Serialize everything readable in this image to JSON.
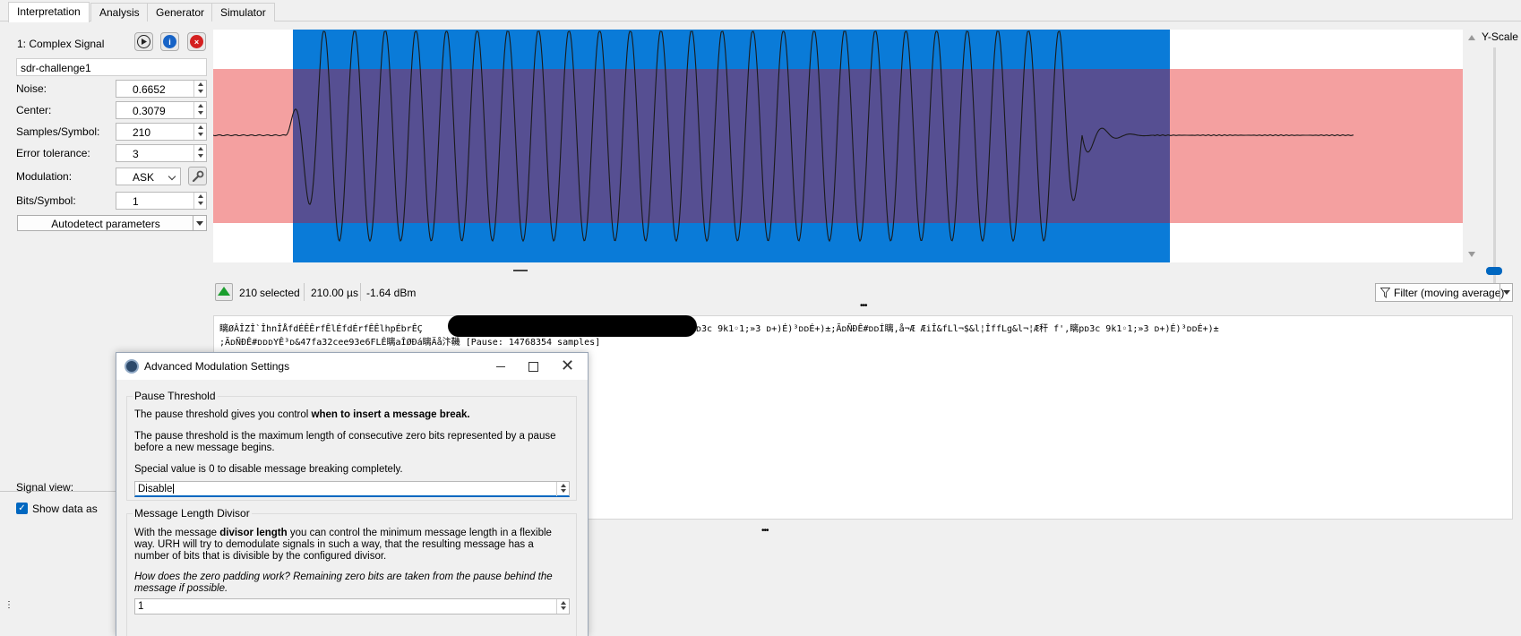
{
  "tabs": [
    {
      "label": "Interpretation"
    },
    {
      "label": "Analysis"
    },
    {
      "label": "Generator"
    },
    {
      "label": "Simulator"
    }
  ],
  "signal": {
    "title": "1:  Complex Signal",
    "name": "sdr-challenge1",
    "noise_label": "Noise:",
    "noise": "0.6652",
    "center_label": "Center:",
    "center": "0.3079",
    "sps_label": "Samples/Symbol:",
    "sps": "210",
    "tol_label": "Error tolerance:",
    "tol": "3",
    "mod_label": "Modulation:",
    "modulation": "ASK",
    "bits_label": "Bits/Symbol:",
    "bits": "1",
    "autodetect": "Autodetect parameters",
    "signal_view_label": "Signal view:",
    "show_data_label": "Show data as"
  },
  "plot": {
    "yscale_label": "Y-Scale",
    "colors": {
      "selection": "#0a7bd8",
      "noise_band": "#f4a0a0",
      "overlap": "#564f92",
      "wave": "#1a1a1a"
    }
  },
  "status": {
    "selected_count": "210",
    "selected_label": "selected",
    "duration": "210.00 µs",
    "power": "-1.64 dBm",
    "filter": "Filter (moving average)"
  },
  "demod": {
    "line1": "瞝ØÂÎZÎ`ÎhnÎÅfdÉÊÊrfÊlÉfdÉrfÊÊlhpÉbrÊÇ",
    "line1b": "ᴅ3c 9k1◦1;»3 ᴅ+)É)³ᴅᴅÉ+)±;ÃᴅÑÐÊ#ᴅᴅÍ瞝,å¬Æ ÆiÎ&fLl¬$&l¦ÎffLg&l¬¦Æ秆 f',瞝pᴅ3c 9k1◦1;»3 ᴅ+)É)³ᴅᴅÉ+)±",
    "line2": ";ÃᴅÑÐÊ#ᴅᴅᴅYÊ³ᴅ&47fa32cee93e6FLÊ瞝aÎØÐá瞝Äå汴鞿 [Pause: 14768354 samples]"
  },
  "dialog": {
    "title": "Advanced Modulation Settings",
    "pause_group": "Pause Threshold",
    "pause_p1_a": "The pause threshold gives you control ",
    "pause_p1_b": "when to insert a message break.",
    "pause_p2": "The pause threshold is the maximum length of consecutive zero bits represented by a pause before a new message begins.",
    "pause_p3": "Special value is 0 to disable message breaking completely.",
    "pause_value": "Disable",
    "len_group": "Message Length Divisor",
    "len_p1_a": "With the message ",
    "len_p1_b": "divisor length",
    "len_p1_c": " you can control the minimum message length in a flexible way. URH will try to demodulate signals in such a way, that the resulting message has a number of bits that is divisible by the configured divisor.",
    "len_p2": "How does the zero padding work? Remaining zero bits are taken from the pause behind the message if possible.",
    "len_value": "1"
  }
}
